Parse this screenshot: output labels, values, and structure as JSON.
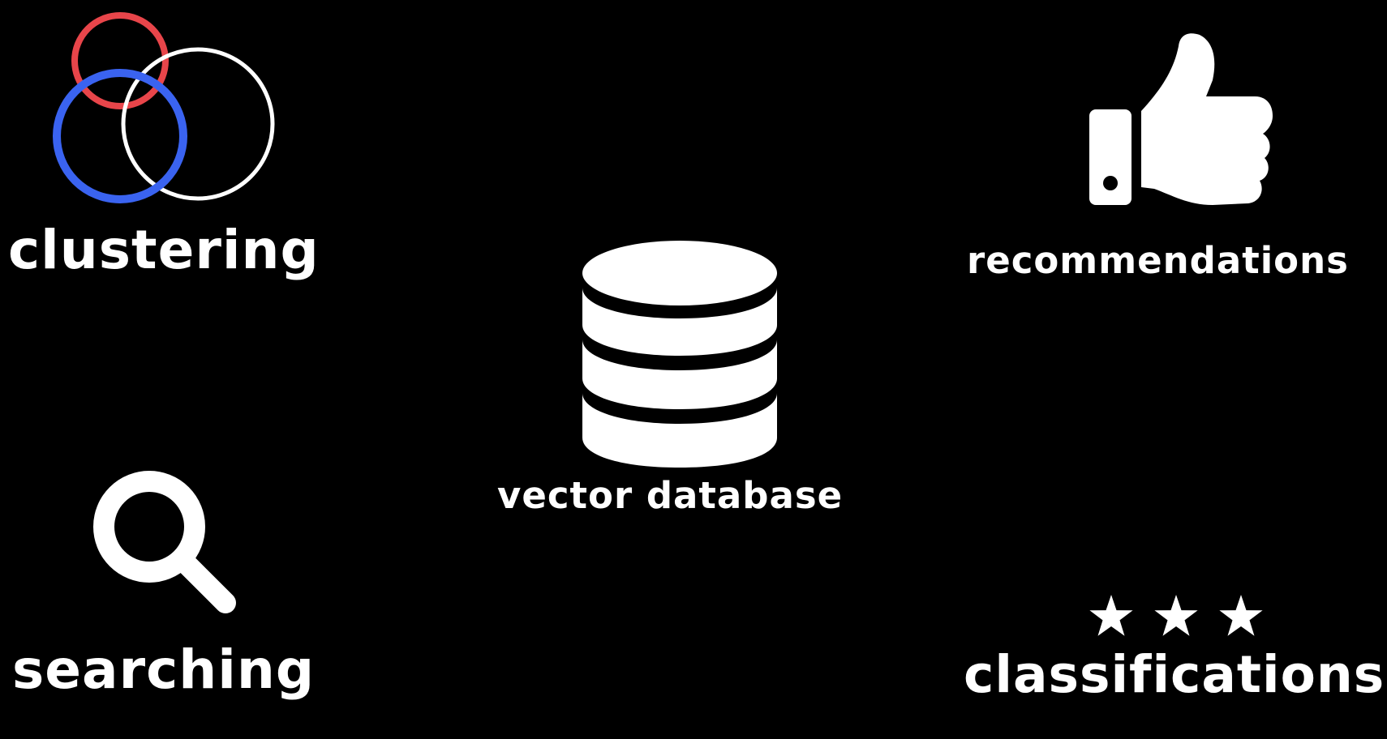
{
  "labels": {
    "clustering": "clustering",
    "searching": "searching",
    "vector_database": "vector database",
    "recommendations": "recommendations",
    "classifications": "classifications"
  },
  "colors": {
    "background": "#000000",
    "foreground": "#ffffff",
    "circle_red": "#e8454a",
    "circle_blue": "#3a63f0"
  },
  "icons": {
    "clustering": "venn-circles-icon",
    "recommendations": "thumbs-up-icon",
    "vector_database": "database-icon",
    "searching": "magnifier-icon",
    "classifications": "stars-icon"
  },
  "classifications": {
    "star_count": 3
  }
}
